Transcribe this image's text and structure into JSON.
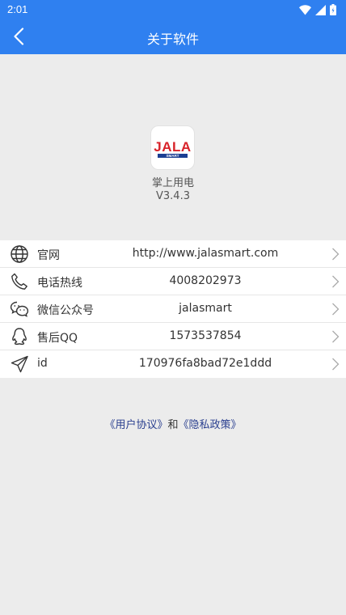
{
  "status_bar": {
    "time": "2:01"
  },
  "header": {
    "title": "关于软件"
  },
  "app": {
    "logo_text": "JALA",
    "logo_sub": "SMART",
    "name": "掌上用电",
    "version": "V3.4.3"
  },
  "info_rows": [
    {
      "icon": "globe-icon",
      "label": "官网",
      "value": "http://www.jalasmart.com"
    },
    {
      "icon": "phone-icon",
      "label": "电话热线",
      "value": "4008202973"
    },
    {
      "icon": "wechat-icon",
      "label": "微信公众号",
      "value": "jalasmart"
    },
    {
      "icon": "qq-icon",
      "label": "售后QQ",
      "value": "1573537854"
    },
    {
      "icon": "send-icon",
      "label": "id",
      "value": "170976fa8bad72e1ddd"
    }
  ],
  "footer": {
    "user_agreement": "《用户协议》",
    "connector": "和",
    "privacy_policy": "《隐私政策》"
  },
  "colors": {
    "header": "#2f80f0",
    "link": "#2a3f8f",
    "background": "#ececec"
  }
}
